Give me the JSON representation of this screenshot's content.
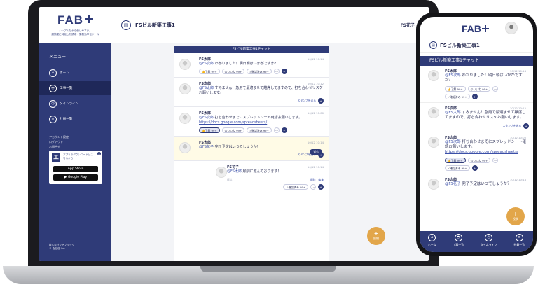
{
  "brand": {
    "logo_text": "FAB",
    "tagline": "シンプルだから使いやすい。\n建築業に特化した請求・業務効率化ツール"
  },
  "sidebar": {
    "menu_heading": "メニュー",
    "items": [
      {
        "label": "ホーム",
        "icon": "home-icon"
      },
      {
        "label": "工事一覧",
        "icon": "helmet-icon"
      },
      {
        "label": "タイムライン",
        "icon": "clock-icon"
      },
      {
        "label": "社員一覧",
        "icon": "list-icon"
      }
    ],
    "sub_links": [
      "アカウント設定",
      "ログアウト",
      "お問合せ"
    ],
    "promo": {
      "text": "アプリのダウンロードはこちらから",
      "app_store": "App Store",
      "google_play": "Google Play"
    },
    "footer": "株式会社ファブリック\n© 会社名 Inc."
  },
  "header": {
    "project_title": "FSビル新築工事1",
    "user_name": "FS花子"
  },
  "chat": {
    "bar_title": "FSビル新築工事1チャット",
    "stamp_label": "スタンプを送る",
    "messages": [
      {
        "name": "FS太郎",
        "time": "10/12 10:14",
        "mention": "@FS次郎",
        "body": "わかりました！明日朝はいかがですか？",
        "reacts": [
          "了解 99+",
          "いいね 99+",
          "確認済み 99+"
        ]
      },
      {
        "name": "FS次郎",
        "time": "10/12 10:12",
        "mention": "@FS太郎",
        "body": "すみません！急用で最適ませて離席してますので、打ち合わせリスケお願いします。",
        "stamp": true
      },
      {
        "name": "FS太郎",
        "time": "10/12 10:00",
        "mention": "@FS次郎",
        "body": "打ち合わせまでにスプレッドシート確認お願いします。",
        "link": "https://docs.google.com/spreadsheets/",
        "reacts": [
          "了解 99+",
          "いいね 99+",
          "確認済み 99+"
        ]
      },
      {
        "name": "FS太郎",
        "time": "10/12 10:14",
        "mention": "@FS花子",
        "body": "完了予定はいつでしょうか？",
        "reply": "返信",
        "stamp": true
      },
      {
        "name": "FS花子",
        "time": "10/12 10:14",
        "mention": "@FS太郎",
        "body": "順調に進んでおります！",
        "reply_state": "返信",
        "edit_label": "編集",
        "delete_label": "削除",
        "reacts": [
          "確認済み 99+"
        ]
      }
    ],
    "fab_label": "投稿"
  },
  "phone": {
    "logo_text": "FAB",
    "project_title": "FSビル新築工事1",
    "bar_title": "FSビル新築工事1チャット",
    "nav": [
      {
        "label": "ホーム",
        "icon": "home-icon"
      },
      {
        "label": "工事一覧",
        "icon": "helmet-icon"
      },
      {
        "label": "タイムライン",
        "icon": "clock-icon"
      },
      {
        "label": "社員一覧",
        "icon": "list-icon"
      }
    ]
  },
  "colors": {
    "primary": "#2f3b78",
    "accent": "#e2a64a",
    "highlight": "#fffbe6"
  }
}
